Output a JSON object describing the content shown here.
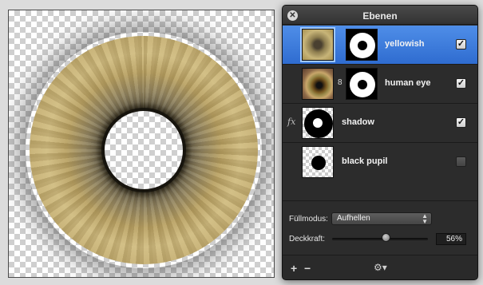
{
  "panel": {
    "title": "Ebenen",
    "close_icon": "close-icon"
  },
  "layers": [
    {
      "name": "yellowish",
      "visible": true,
      "selected": true,
      "has_mask": true
    },
    {
      "name": "human eye",
      "visible": true,
      "selected": false,
      "has_mask": true,
      "linked": true
    },
    {
      "name": "shadow",
      "visible": true,
      "selected": false,
      "has_effects": true,
      "fx_label": "fx"
    },
    {
      "name": "black pupil",
      "visible": false,
      "selected": false
    }
  ],
  "properties": {
    "blend_label": "Füllmodus:",
    "blend_value": "Aufhellen",
    "opacity_label": "Deckkraft:",
    "opacity_value": "56%",
    "opacity_fraction": 0.56
  },
  "bottom_bar": {
    "add_label": "+",
    "remove_label": "−",
    "gear_icon": "gear-icon"
  },
  "colors": {
    "selection": "#3a7ad8",
    "panel_bg": "#2c2c2c"
  }
}
